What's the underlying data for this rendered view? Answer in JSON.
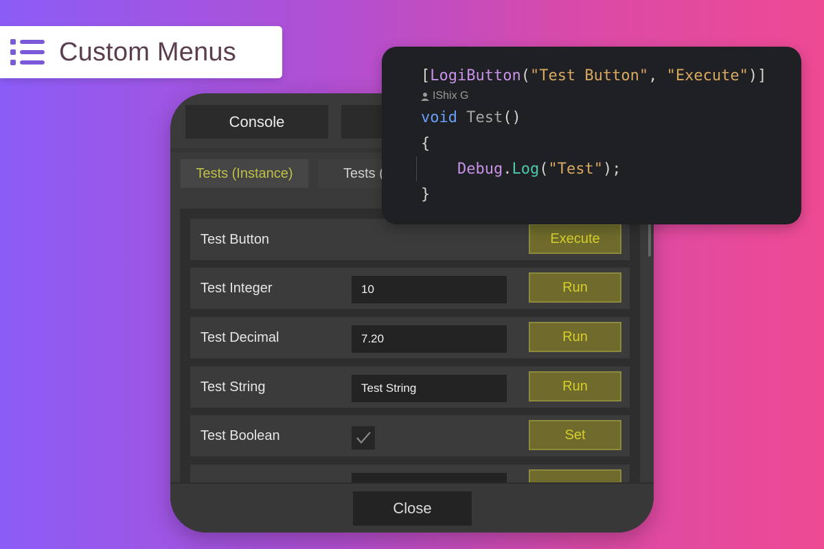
{
  "header": {
    "title": "Custom Menus",
    "icon": "list-icon"
  },
  "panel": {
    "top_tabs": [
      "Console",
      ""
    ],
    "sub_tabs": [
      "Tests (Instance)",
      "Tests ("
    ],
    "rows": [
      {
        "label": "Test Button",
        "value": "",
        "button": "Execute"
      },
      {
        "label": "Test Integer",
        "value": "10",
        "button": "Run"
      },
      {
        "label": "Test Decimal",
        "value": "7.20",
        "button": "Run"
      },
      {
        "label": "Test String",
        "value": "Test String",
        "button": "Run"
      },
      {
        "label": "Test Boolean",
        "checked": true,
        "button": "Set"
      }
    ],
    "close_label": "Close"
  },
  "code": {
    "line1_a": "[",
    "line1_attr": "LogiButton",
    "line1_b": "(",
    "line1_str1": "\"Test Button\"",
    "line1_c": ", ",
    "line1_str2": "\"Execute\"",
    "line1_d": ")]",
    "author": "IShix G",
    "line2_kw": "void",
    "line2_fn": "Test",
    "line2_rest": "()",
    "line3": "{",
    "line4_type": "Debug",
    "line4_dot": ".",
    "line4_call": "Log",
    "line4_a": "(",
    "line4_str": "\"Test\"",
    "line4_b": ");",
    "line5": "}"
  },
  "colors": {
    "accent_yellow": "#d8cf2c",
    "active_tab_text": "#bfc048",
    "gradient_start": "#8b5cf6",
    "gradient_end": "#ee4a93"
  }
}
